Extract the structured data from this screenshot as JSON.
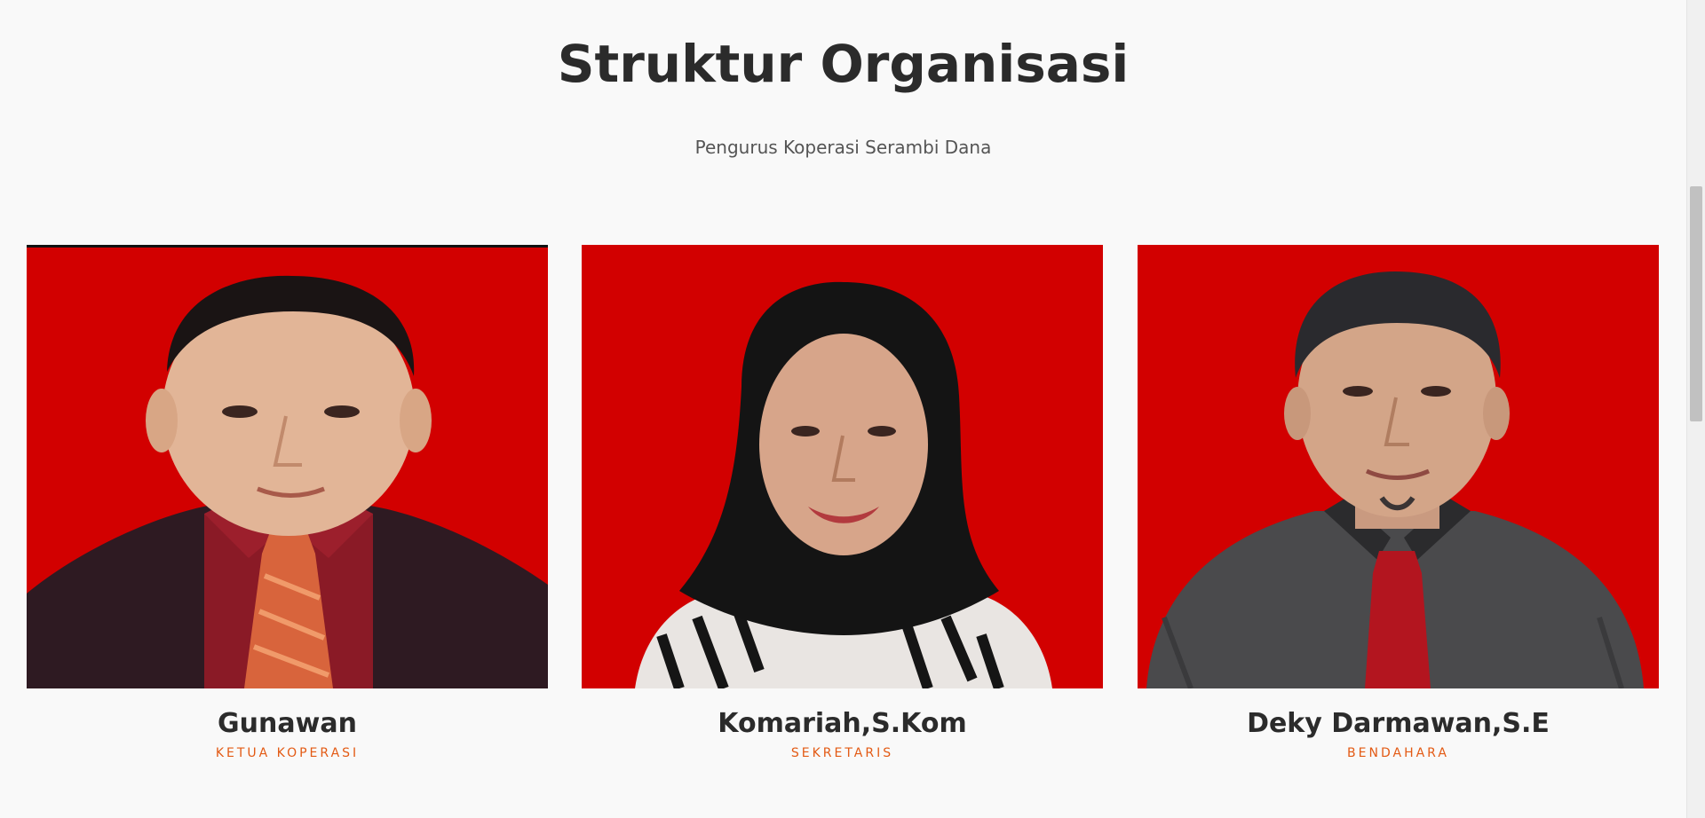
{
  "section": {
    "title": "Struktur Organisasi",
    "subtitle": "Pengurus Koperasi Serambi Dana"
  },
  "members": [
    {
      "name": "Gunawan",
      "role": "KETUA KOPERASI"
    },
    {
      "name": "Komariah,S.Kom",
      "role": "SEKRETARIS"
    },
    {
      "name": "Deky Darmawan,S.E",
      "role": "BENDAHARA"
    }
  ],
  "colors": {
    "photo_background": "#d20000",
    "role_accent": "#e35a14",
    "heading": "#2b2b2b",
    "page_background": "#f9f9f9"
  }
}
